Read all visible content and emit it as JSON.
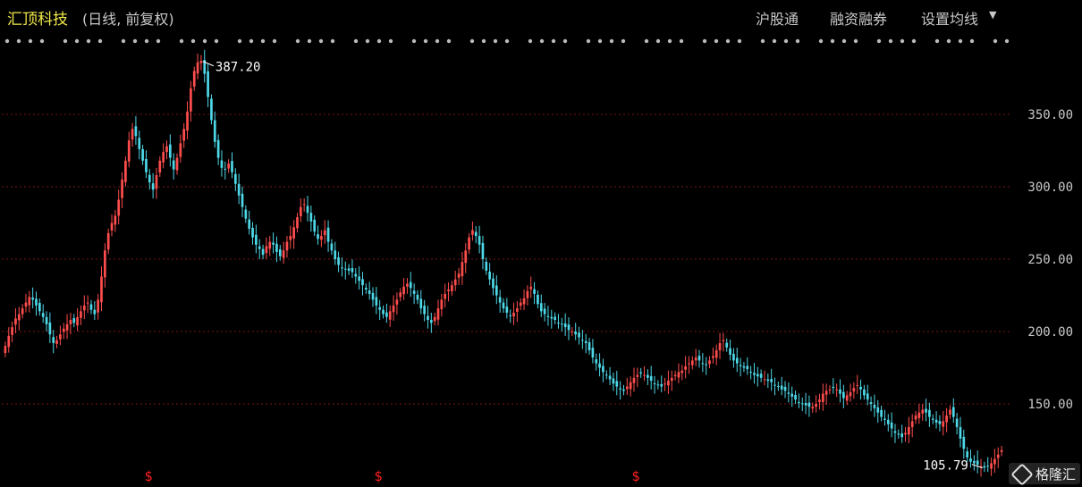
{
  "header": {
    "title": "汇顶科技",
    "subtitle": "(日线, 前复权)",
    "menu": [
      "沪股通",
      "融资融券",
      "设置均线"
    ]
  },
  "colors": {
    "up": "#ff4d4d",
    "down": "#4dd8e8",
    "grid": "#7a1414",
    "axis_text": "#c8c8c8",
    "title": "#f0e84a",
    "marker": "#ff2020"
  },
  "watermark": {
    "text": "格隆汇"
  },
  "chart_data": {
    "type": "candlestick",
    "title": "汇顶科技",
    "y_ticks": [
      350,
      300,
      250,
      200,
      150
    ],
    "y_tick_labels": [
      "350.00",
      "300.00",
      "250.00",
      "200.00",
      "150.00"
    ],
    "ylim": [
      105,
      390
    ],
    "grid": true,
    "annotations": {
      "high": "387.20",
      "low": "105.79"
    },
    "event_marker_glyph": "$",
    "event_marker_count": 3,
    "closes": [
      190,
      197,
      203,
      209,
      212,
      216,
      220,
      224,
      222,
      218,
      214,
      210,
      205,
      198,
      192,
      194,
      198,
      202,
      205,
      208,
      206,
      210,
      214,
      218,
      220,
      215,
      212,
      222,
      238,
      256,
      268,
      275,
      280,
      291,
      305,
      318,
      332,
      340,
      335,
      326,
      318,
      310,
      303,
      298,
      308,
      318,
      324,
      328,
      320,
      312,
      320,
      330,
      340,
      352,
      368,
      380,
      386,
      387,
      378,
      362,
      346,
      331,
      320,
      313,
      312,
      316,
      310,
      302,
      294,
      286,
      278,
      271,
      265,
      260,
      257,
      253,
      259,
      262,
      260,
      255,
      252,
      256,
      262,
      266,
      272,
      279,
      286,
      288,
      282,
      276,
      269,
      264,
      266,
      270,
      262,
      256,
      250,
      246,
      244,
      243,
      242,
      241,
      238,
      235,
      232,
      229,
      226,
      222,
      218,
      215,
      212,
      210,
      214,
      218,
      222,
      227,
      231,
      233,
      230,
      226,
      222,
      216,
      212,
      208,
      206,
      210,
      216,
      222,
      226,
      229,
      232,
      236,
      240,
      248,
      256,
      265,
      270,
      266,
      260,
      250,
      242,
      236,
      230,
      225,
      220,
      216,
      213,
      211,
      213,
      216,
      220,
      223,
      228,
      231,
      226,
      219,
      214,
      212,
      210,
      209,
      208,
      206,
      205,
      203,
      201,
      200,
      198,
      196,
      194,
      192,
      187,
      182,
      178,
      175,
      172,
      170,
      167,
      164,
      162,
      160,
      159,
      162,
      165,
      168,
      170,
      171,
      170,
      168,
      166,
      164,
      163,
      162,
      164,
      166,
      168,
      170,
      172,
      173,
      176,
      178,
      180,
      182,
      180,
      178,
      177,
      180,
      183,
      187,
      192,
      194,
      189,
      184,
      180,
      178,
      176,
      175,
      174,
      172,
      170,
      169,
      168,
      167,
      166,
      165,
      163,
      162,
      160,
      159,
      157,
      155,
      153,
      151,
      150,
      149,
      148,
      148,
      150,
      153,
      157,
      159,
      160,
      161,
      160,
      157,
      154,
      156,
      158,
      161,
      163,
      160,
      156,
      153,
      150,
      147,
      144,
      141,
      139,
      136,
      133,
      130,
      129,
      127,
      130,
      134,
      138,
      142,
      144,
      146,
      144,
      141,
      139,
      137,
      136,
      138,
      142,
      146,
      141,
      134,
      126,
      119,
      113,
      110,
      109,
      108,
      107,
      106,
      107,
      109,
      112,
      115,
      118
    ]
  }
}
